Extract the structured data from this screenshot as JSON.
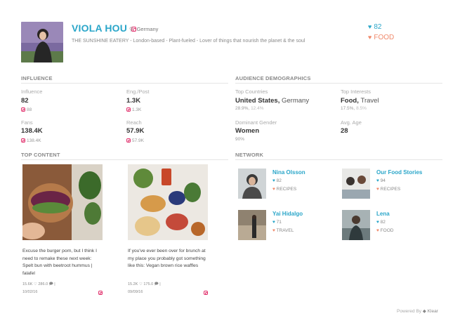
{
  "profile": {
    "name": "VIOLA HOU",
    "location": "Germany",
    "bio": "THE SUNSHINE EATERY - London-based - Plant-fueled - Lover of things that nourish the planet & the soul",
    "score": "82",
    "category": "FOOD"
  },
  "influence": {
    "title": "INFLUENCE",
    "influence_label": "Influence",
    "influence_value": "82",
    "influence_sub": "88",
    "eng_label": "Eng./Post",
    "eng_value": "1.3K",
    "eng_sub": "1.3K",
    "fans_label": "Fans",
    "fans_value": "138.4K",
    "fans_sub": "138.4K",
    "reach_label": "Reach",
    "reach_value": "57.9K",
    "reach_sub": "57.9K"
  },
  "demographics": {
    "title": "AUDIENCE DEMOGRAPHICS",
    "countries_label": "Top Countries",
    "country1": "United States,",
    "country2": "Germany",
    "country1_pct": "28.9%,",
    "country2_pct": "12.4%",
    "interests_label": "Top Interests",
    "interest1": "Food,",
    "interest2": "Travel",
    "interest1_pct": "17.5%,",
    "interest2_pct": "8.5%",
    "gender_label": "Dominant Gender",
    "gender_value": "Women",
    "gender_pct": "90%",
    "age_label": "Avg. Age",
    "age_value": "28"
  },
  "top_content": {
    "title": "TOP CONTENT",
    "posts": [
      {
        "caption": "Excuse the burger porn, but I think I need to remake these next week: Spelt bun with beetroot hummus | falafel",
        "likes": "15.6K",
        "comments": "286.0",
        "date": "10/02/16"
      },
      {
        "caption": "If you've ever been over for brunch at my place you probably got something like this: Vegan brown rice waffles",
        "likes": "15.2K",
        "comments": "175.0",
        "date": "09/09/16"
      }
    ]
  },
  "network": {
    "title": "NETWORK",
    "items": [
      {
        "name": "Nina Olsson",
        "score": "82",
        "category": "RECIPES"
      },
      {
        "name": "Our Food Stories",
        "score": "94",
        "category": "RECIPES"
      },
      {
        "name": "Yai Hidalgo",
        "score": "71",
        "category": "TRAVEL"
      },
      {
        "name": "Lena",
        "score": "82",
        "category": "FOOD"
      }
    ]
  },
  "footer": {
    "powered_by": "Powered By",
    "brand": "Klear"
  },
  "colors": {
    "accent_blue": "#2aa6c9",
    "accent_orange": "#f08a6c",
    "instagram": "#e1306c"
  }
}
